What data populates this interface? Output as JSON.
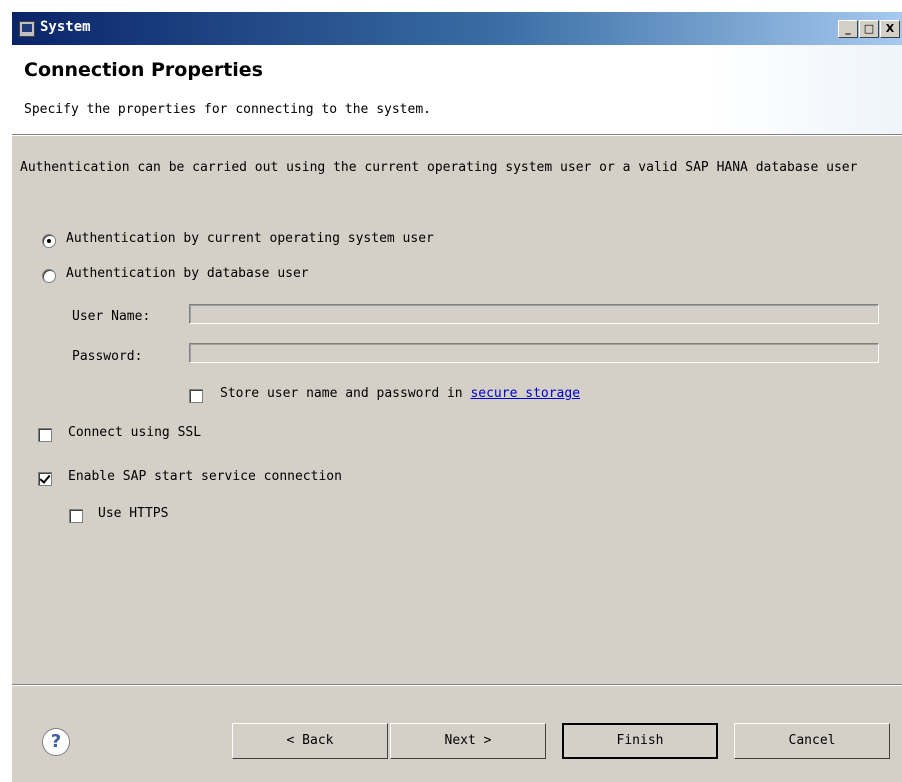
{
  "window": {
    "title": "System"
  },
  "titlebar_buttons": {
    "minimize": "_",
    "maximize": "□",
    "close": "X"
  },
  "banner": {
    "title": "Connection Properties",
    "description": "Specify the properties for connecting to the system."
  },
  "intro": {
    "text": "Authentication can be carried out using the current operating system user or a valid SAP HANA database user"
  },
  "auth": {
    "os_user_label": "Authentication by current operating system user",
    "os_user_selected": true,
    "db_user_label": "Authentication by database user",
    "db_user_selected": false
  },
  "fields": {
    "username_label": "User Name:",
    "username_value": "",
    "password_label": "Password:",
    "password_value": ""
  },
  "store": {
    "prefix": "Store user name and password in ",
    "link": "secure storage",
    "checked": false
  },
  "ssl": {
    "label": "Connect using SSL",
    "checked": false
  },
  "start_service": {
    "label": "Enable SAP start service connection",
    "checked": true
  },
  "https": {
    "label": "Use HTTPS",
    "checked": false
  },
  "footer": {
    "help_glyph": "?",
    "back": "< Back",
    "next": "Next >",
    "finish": "Finish",
    "cancel": "Cancel"
  },
  "icons": [
    "app-icon",
    "help-icon"
  ]
}
